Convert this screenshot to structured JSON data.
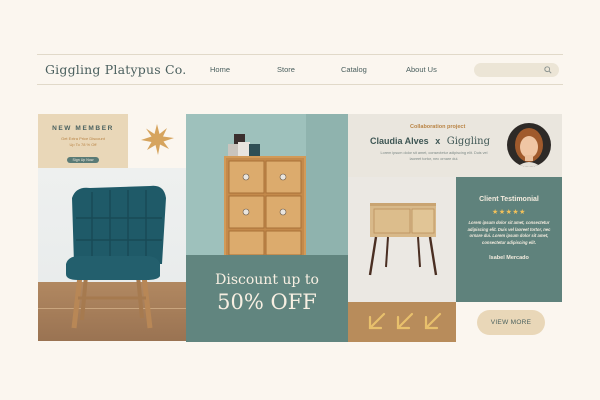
{
  "nav": {
    "brand": "Giggling Platypus Co.",
    "links": [
      "Home",
      "Store",
      "Catalog",
      "About Us"
    ],
    "search_icon": "search-icon"
  },
  "member": {
    "title": "NEW MEMBER",
    "sub1": "Get Extra Price Discount",
    "sub2": "Up To 78 % Off",
    "button": "Sign Up Now"
  },
  "discount": {
    "line1": "Discount up to",
    "line2": "50% OFF"
  },
  "collab": {
    "tag": "Collaboration project",
    "person": "Claudia Alves",
    "cross": "x",
    "brand": "Giggling",
    "desc": "Lorem ipsum dolor sit amet, consectetur adipiscing elit. Duis vel laoreet tortor, nec ornare dui."
  },
  "testimonial": {
    "title": "Client Testimonial",
    "stars": "★★★★★",
    "body": "Lorem ipsum dolor sit amet, consectetur adipiscing elit. Duis vel laoreet tortor, nec ornare dui. Lorem ipsum dolor sit amet, consectetur adipiscing elit.",
    "name": "Isabel Mercado"
  },
  "cta": {
    "view_more": "VIEW MORE"
  },
  "colors": {
    "teal": "#61857f",
    "cream": "#fbf6ef",
    "beige": "#e9d7b8",
    "mustard": "#b88c5b",
    "star_gold": "#f2c15a"
  }
}
